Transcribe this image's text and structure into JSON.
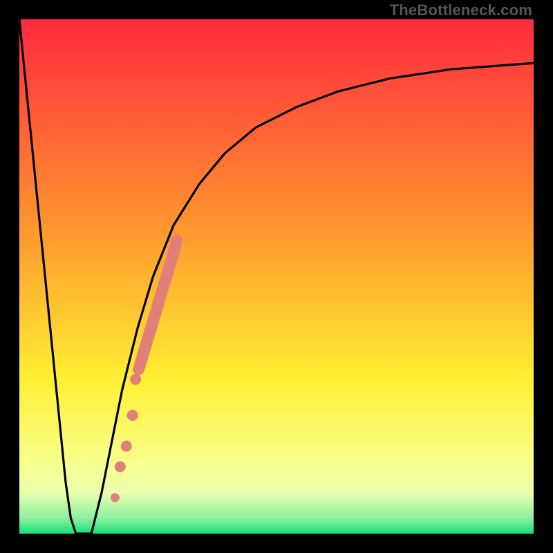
{
  "watermark": "TheBottleneck.com",
  "colors": {
    "frame": "#000000",
    "gradient_top": "#ff2a3f",
    "gradient_mid1": "#ff7a2e",
    "gradient_mid2": "#ffef33",
    "gradient_band": "#f8ffb0",
    "gradient_bottom": "#15e07a",
    "curve": "#000000",
    "highlight": "#e08078"
  },
  "chart_data": {
    "type": "line",
    "title": "",
    "xlabel": "",
    "ylabel": "",
    "xlim": [
      0,
      100
    ],
    "ylim": [
      0,
      100
    ],
    "grid": false,
    "legend": false,
    "annotations": [
      "TheBottleneck.com"
    ],
    "series": [
      {
        "name": "curve-left",
        "x": [
          0,
          2,
          4,
          6,
          8,
          9,
          10,
          11
        ],
        "y": [
          100,
          80,
          60,
          40,
          20,
          10,
          3,
          0
        ]
      },
      {
        "name": "curve-floor",
        "x": [
          11,
          12,
          13,
          14
        ],
        "y": [
          0,
          0,
          0,
          0
        ]
      },
      {
        "name": "curve-right",
        "x": [
          14,
          16,
          18,
          20,
          23,
          26,
          30,
          35,
          40,
          46,
          54,
          62,
          72,
          84,
          100
        ],
        "y": [
          0,
          8,
          18,
          28,
          40,
          50,
          60,
          68,
          74,
          79,
          83,
          86,
          88.5,
          90.3,
          91.5
        ]
      }
    ],
    "highlight_points": {
      "name": "highlight",
      "x": [
        18.6,
        19.6,
        20.8,
        22.0,
        22.6,
        23.2,
        23.8,
        24.4,
        25.0,
        25.6,
        26.2,
        26.8,
        27.4,
        28.0,
        28.6,
        29.2,
        29.8,
        30.6
      ],
      "y": [
        7,
        13,
        17,
        23,
        30,
        32,
        34,
        36,
        38,
        40,
        42,
        44,
        46,
        48,
        50,
        52,
        54,
        57
      ]
    }
  }
}
